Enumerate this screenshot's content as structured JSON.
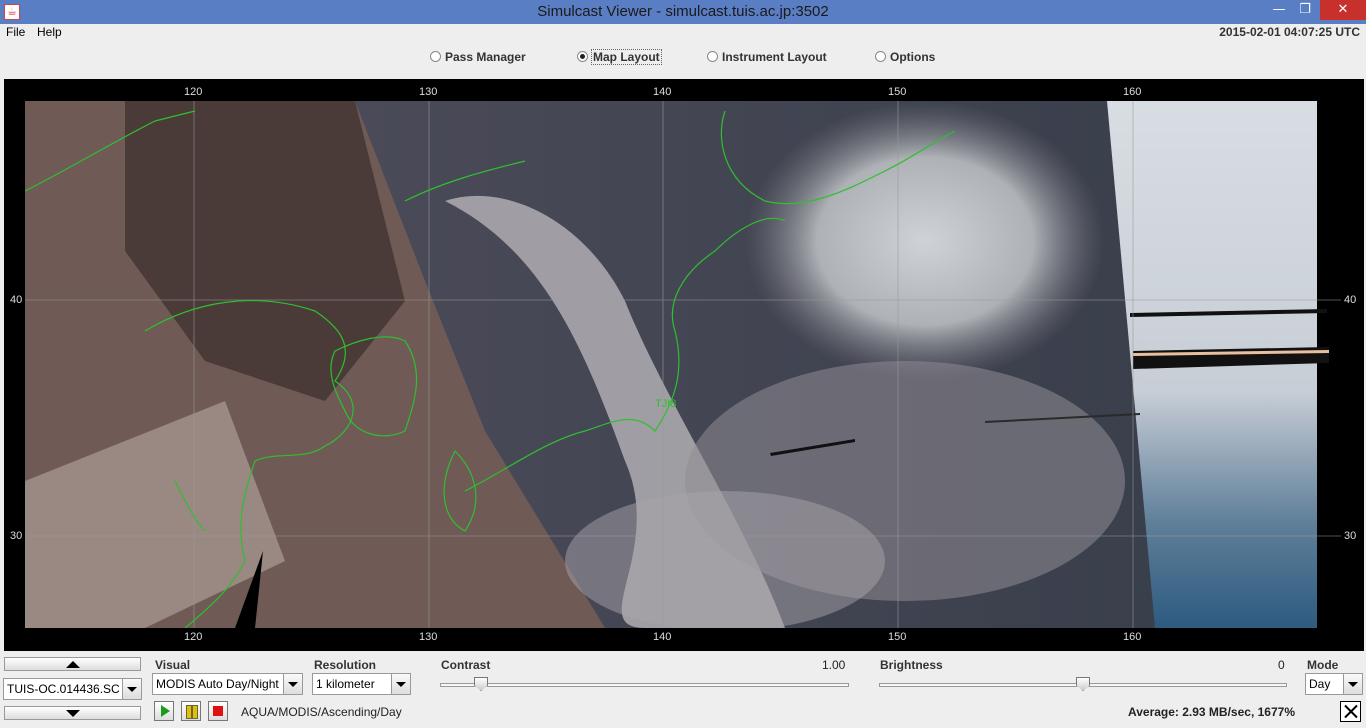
{
  "window": {
    "title": "Simulcast Viewer - simulcast.tuis.ac.jp:3502",
    "min_symbol": "—",
    "max_symbol": "❐",
    "close_symbol": "✕"
  },
  "menu": {
    "file": "File",
    "help": "Help"
  },
  "clock": "2015-02-01 04:07:25 UTC",
  "tabs": [
    {
      "label": "Pass Manager",
      "selected": false
    },
    {
      "label": "Map Layout",
      "selected": true
    },
    {
      "label": "Instrument Layout",
      "selected": false
    },
    {
      "label": "Options",
      "selected": false
    }
  ],
  "map": {
    "lon_labels": [
      "120",
      "130",
      "140",
      "150",
      "160"
    ],
    "lat_labels": [
      "40",
      "30"
    ],
    "station_label": "TJI8"
  },
  "controls": {
    "pass_name": "TUIS-OC.014436.SC",
    "visual_label": "Visual",
    "visual_value": "MODIS Auto Day/Night",
    "resolution_label": "Resolution",
    "resolution_value": "1 kilometer",
    "contrast_label": "Contrast",
    "contrast_value": "1.00",
    "contrast_level": 0.05,
    "brightness_label": "Brightness",
    "brightness_value": "0",
    "brightness_level": 0.5,
    "mode_label": "Mode",
    "mode_value": "Day",
    "pass_info": "AQUA/MODIS/Ascending/Day",
    "average": "Average: 2.93 MB/sec, 1677%"
  },
  "colors": {
    "titlebar": "#5a7ec4",
    "coastline": "#2fbf2f",
    "close_button": "#c7302b"
  }
}
